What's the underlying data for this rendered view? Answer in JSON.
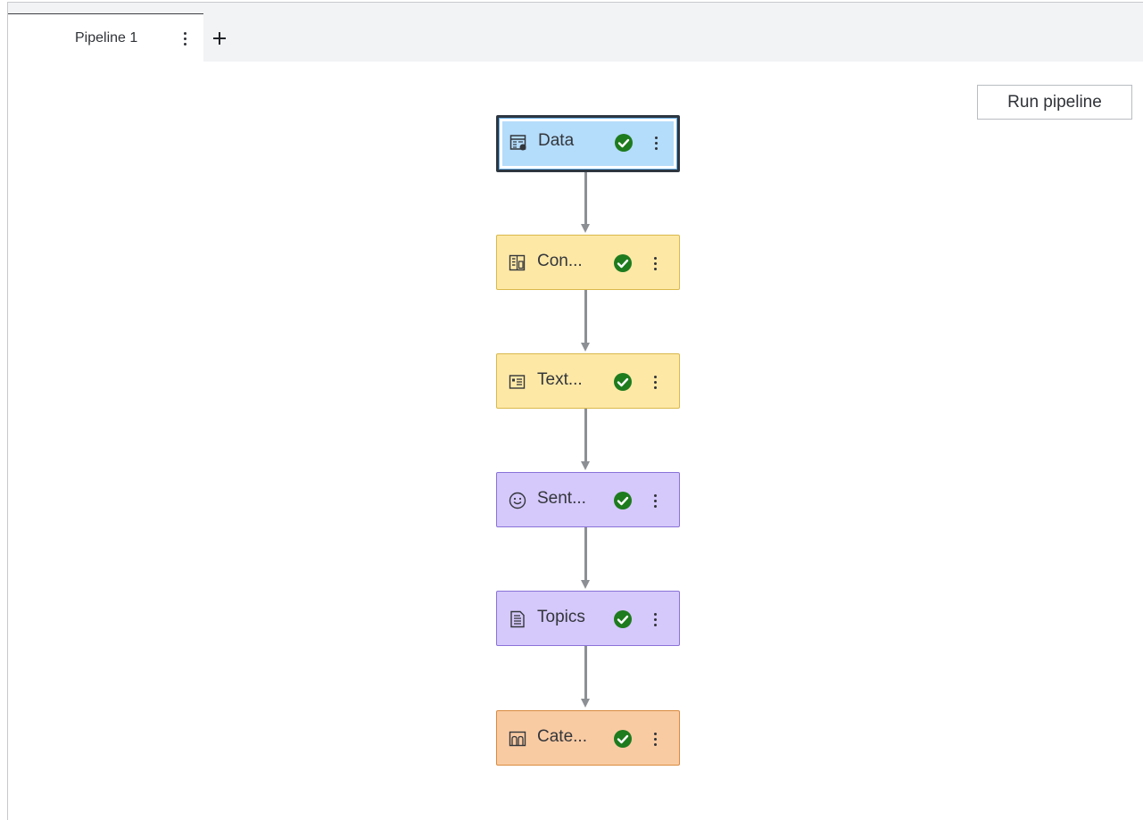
{
  "tabs": [
    {
      "label": "Pipeline 1",
      "active": true
    }
  ],
  "toolbar": {
    "run_label": "Run pipeline"
  },
  "nodes": [
    {
      "label": "Data",
      "icon": "data-table-icon",
      "status": "complete",
      "color": "#b4dcfb",
      "selected": true
    },
    {
      "label": "Con...",
      "icon": "concepts-icon",
      "status": "complete",
      "color": "#fde8a6"
    },
    {
      "label": "Text...",
      "icon": "text-parsing-icon",
      "status": "complete",
      "color": "#fde8a6"
    },
    {
      "label": "Sent...",
      "icon": "smiley-icon",
      "status": "complete",
      "color": "#d5c8fb"
    },
    {
      "label": "Topics",
      "icon": "document-lines-icon",
      "status": "complete",
      "color": "#d5c8fb"
    },
    {
      "label": "Cate...",
      "icon": "categories-icon",
      "status": "complete",
      "color": "#f9cba3"
    }
  ],
  "colors": {
    "status_success": "#1e7b1e",
    "edge": "#8c8f94"
  }
}
